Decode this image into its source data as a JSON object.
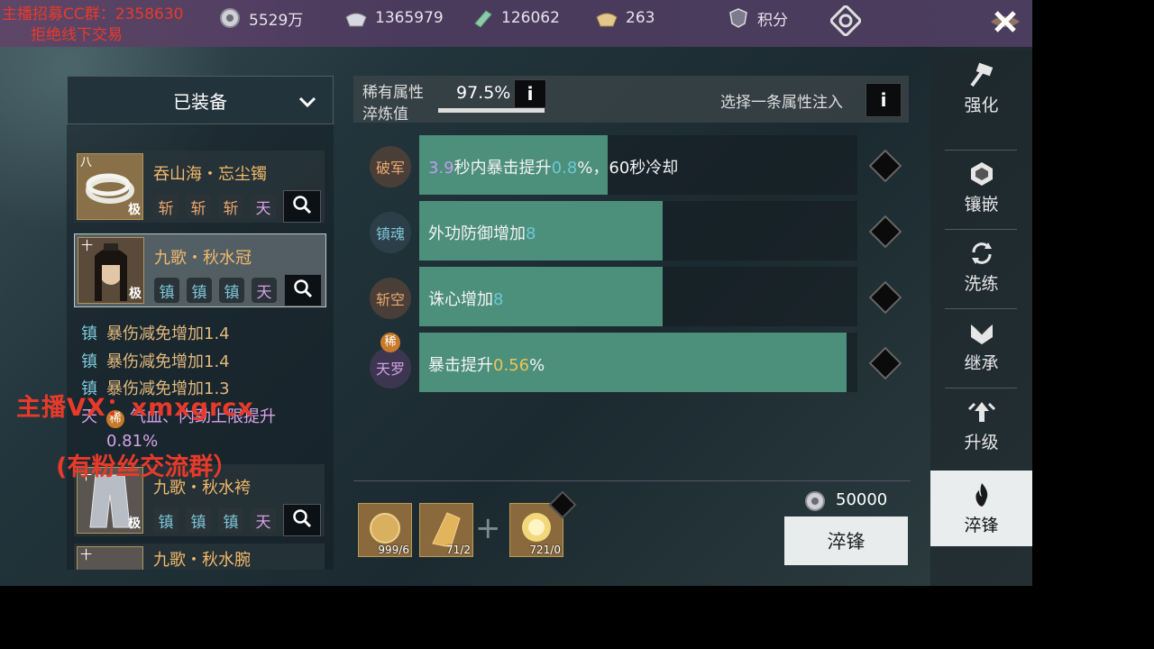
{
  "topbar": {
    "resources": [
      {
        "icon": "coin-icon",
        "value": "5529万"
      },
      {
        "icon": "silver-ingot-icon",
        "value": "1365979"
      },
      {
        "icon": "jade-icon",
        "value": "126062"
      },
      {
        "icon": "gold-ingot-icon",
        "value": "263"
      }
    ],
    "points_label": "积分"
  },
  "overlays": {
    "recruit_line1": "主播招募CC群：2358630",
    "recruit_line2": "拒绝线下交易",
    "vx_line": "主播VX：xmxgrcx",
    "fans_line": "(有粉丝交流群）"
  },
  "left_panel": {
    "dropdown_label": "已装备",
    "items": [
      {
        "tier": "八",
        "grade": "极",
        "name": "吞山海・忘尘镯",
        "chips": [
          "斩",
          "斩",
          "斩",
          "天"
        ]
      },
      {
        "tier": "十",
        "grade": "极",
        "name": "九歌・秋水冠",
        "chips": [
          "镇",
          "镇",
          "镇",
          "天"
        ]
      },
      {
        "tier": "十",
        "grade": "极",
        "name": "九歌・秋水袴",
        "chips": [
          "镇",
          "镇",
          "镇",
          "天"
        ]
      },
      {
        "tier": "十",
        "grade": "",
        "name": "九歌・秋水腕",
        "chips": []
      }
    ],
    "stats": [
      {
        "tag": "镇",
        "text": "暴伤减免增加1.4"
      },
      {
        "tag": "镇",
        "text": "暴伤减免增加1.4"
      },
      {
        "tag": "镇",
        "text": "暴伤减免增加1.3"
      },
      {
        "tag": "天",
        "rare": "稀",
        "text": "气血、内劲上限提升",
        "text2": "0.81%"
      }
    ]
  },
  "rare_bar": {
    "label_line1": "稀有属性",
    "label_line2": "淬炼值",
    "percent": "97.5%",
    "percent_value": 97.5,
    "info_label": "i",
    "inject_label": "选择一条属性注入"
  },
  "attributes": [
    {
      "badge": "破军",
      "fill": 0.43,
      "parts": [
        "3.9",
        "秒内暴击提升",
        "0.8",
        "%，60秒冷却"
      ]
    },
    {
      "badge": "镇魂",
      "fill": 0.555,
      "parts": [
        "外功防御增加",
        "8"
      ]
    },
    {
      "badge": "斩空",
      "fill": 0.555,
      "parts": [
        "诛心增加",
        "8"
      ]
    },
    {
      "badge": "天罗",
      "rare": "稀",
      "fill": 0.975,
      "parts": [
        "暴击提升",
        "0.56",
        "%"
      ]
    }
  ],
  "materials": [
    {
      "count": "999/6"
    },
    {
      "count": "71/2"
    },
    {
      "count": "721/0"
    }
  ],
  "cost": "50000",
  "action_button": "淬锋",
  "nav": [
    {
      "label": "强化",
      "icon": "hammer-icon"
    },
    {
      "label": "镶嵌",
      "icon": "gem-icon"
    },
    {
      "label": "洗练",
      "icon": "refresh-icon"
    },
    {
      "label": "继承",
      "icon": "inherit-icon"
    },
    {
      "label": "升级",
      "icon": "upgrade-icon"
    },
    {
      "label": "淬锋",
      "icon": "flame-icon"
    }
  ],
  "colors": {
    "accent_fill": "#4c8f7a",
    "gold_text": "#f2b96b",
    "cyan_value": "#6ec6d8"
  }
}
